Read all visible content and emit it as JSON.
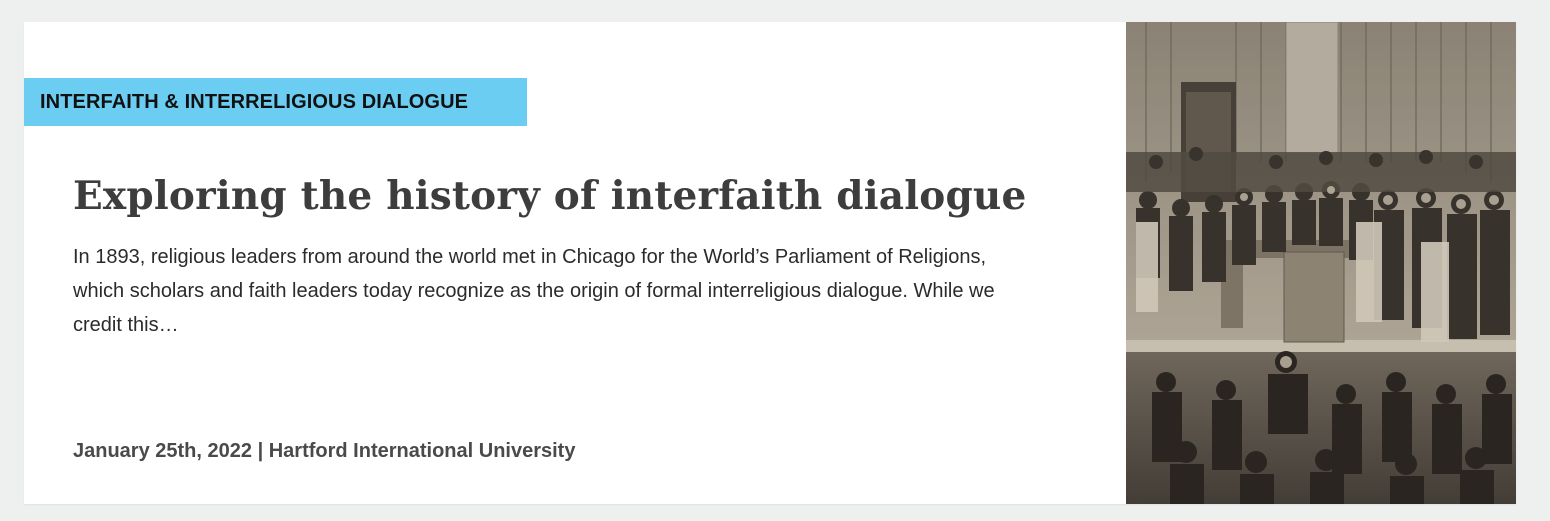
{
  "card": {
    "category": "INTERFAITH & INTERRELIGIOUS DIALOGUE",
    "title": "Exploring the history of interfaith dialogue",
    "excerpt": "In 1893, religious leaders from around the world met in Chicago for the World’s Parliament of Religions, which scholars and faith leaders today recognize as the origin of formal interreligious dialogue. While we credit this…",
    "date": "January 25th, 2022",
    "separator": "|",
    "publisher": "Hartford International University"
  },
  "colors": {
    "tag_background": "#6ccdf2",
    "page_background": "#eef0ef",
    "title_color": "#3d3d3d"
  }
}
